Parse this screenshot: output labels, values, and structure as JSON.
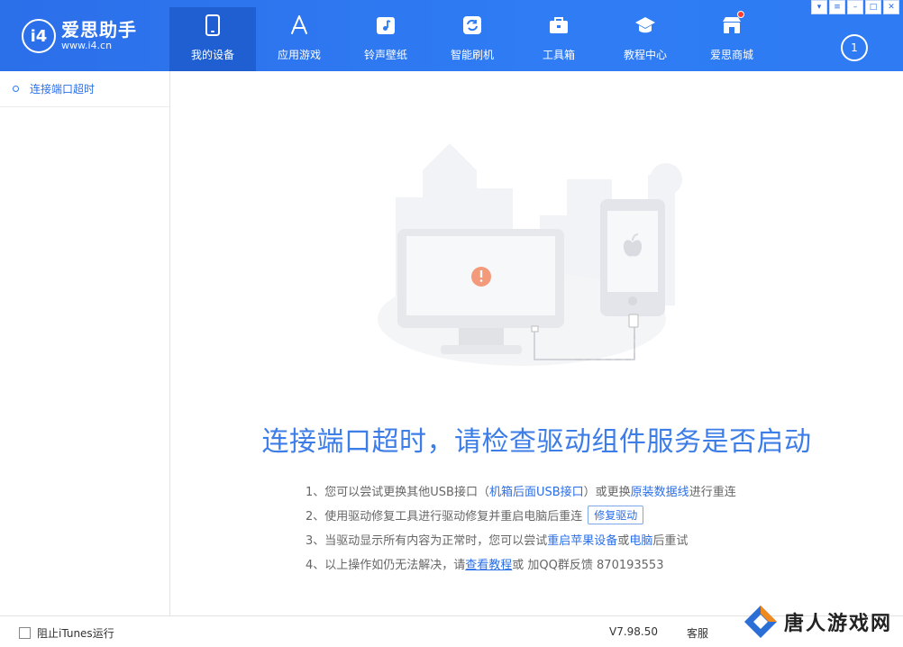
{
  "app": {
    "logo_mark": "i4",
    "logo_title": "爱思助手",
    "logo_url": "www.i4.cn"
  },
  "nav": {
    "items": [
      {
        "label": "我的设备",
        "icon": "phone-icon",
        "active": true
      },
      {
        "label": "应用游戏",
        "icon": "app-store-icon",
        "active": false
      },
      {
        "label": "铃声壁纸",
        "icon": "music-icon",
        "active": false
      },
      {
        "label": "智能刷机",
        "icon": "refresh-icon",
        "active": false
      },
      {
        "label": "工具箱",
        "icon": "toolbox-icon",
        "active": false
      },
      {
        "label": "教程中心",
        "icon": "graduation-cap-icon",
        "active": false
      },
      {
        "label": "爱思商城",
        "icon": "shop-icon",
        "active": false
      }
    ],
    "download_count": "1"
  },
  "window_controls": {
    "skin": "▾",
    "menu": "≡",
    "minimize": "–",
    "maximize": "□",
    "close": "✕"
  },
  "sidebar": {
    "items": [
      {
        "label": "连接端口超时"
      }
    ]
  },
  "main": {
    "headline": "连接端口超时，请检查驱动组件服务是否启动",
    "steps": {
      "s1_pre": "1、您可以尝试更换其他USB接口（",
      "s1_link1": "机箱后面USB接口",
      "s1_mid": "）或更换",
      "s1_link2": "原装数据线",
      "s1_post": "进行重连",
      "s2_pre": "2、使用驱动修复工具进行驱动修复并重启电脑后重连",
      "s2_button": "修复驱动",
      "s3_pre": "3、当驱动显示所有内容为正常时，您可以尝试",
      "s3_link1": "重启苹果设备",
      "s3_mid": "或",
      "s3_link2": "电脑",
      "s3_post": "后重试",
      "s4_pre": "4、以上操作如仍无法解决，请 ",
      "s4_link": "查看教程",
      "s4_post": " 或 加QQ群反馈 870193553"
    }
  },
  "bottombar": {
    "itunes_block_label": "阻止iTunes运行",
    "version": "V7.98.50",
    "service": "客服"
  },
  "watermark": {
    "text": "唐人游戏网"
  },
  "colors": {
    "topbar": "#2e7bf3",
    "active_nav": "#1f5fd1",
    "link": "#2a6fe8",
    "headline": "#3d7de8",
    "warning": "#f29a7a"
  }
}
